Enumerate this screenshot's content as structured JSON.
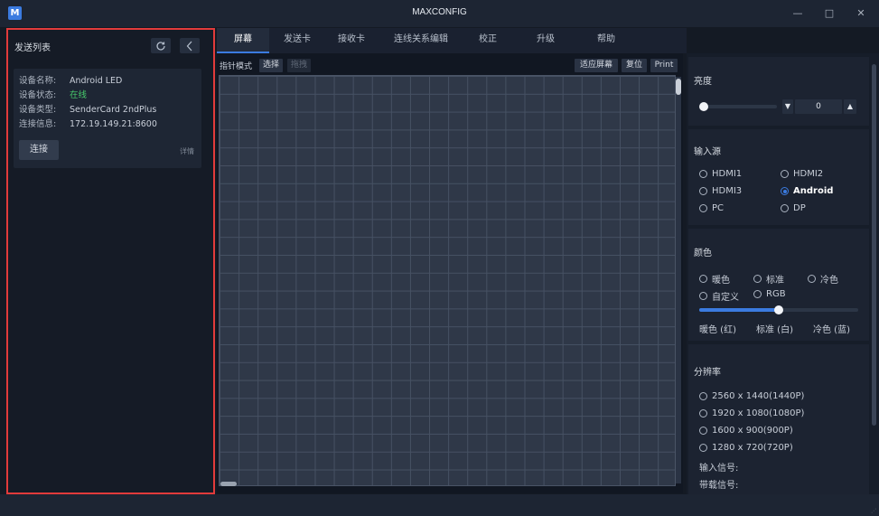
{
  "window": {
    "logo_text": "M",
    "title": "MAXCONFIG",
    "controls": {
      "minimize": "—",
      "maximize": "□",
      "close": "✕"
    }
  },
  "left_panel": {
    "title": "发送列表",
    "refresh_icon": "refresh-icon",
    "collapse_icon": "chevron-left-icon",
    "device": {
      "name_label": "设备名称:",
      "name_value": "Android LED",
      "status_label": "设备状态:",
      "status_value": "在线",
      "type_label": "设备类型:",
      "type_value": "SenderCard 2ndPlus",
      "conn_label": "连接信息:",
      "conn_value": "172.19.149.21:8600",
      "connect_button": "连接",
      "detail_link": "详情"
    }
  },
  "tabs": [
    {
      "label": "屏幕",
      "active": true
    },
    {
      "label": "发送卡",
      "active": false
    },
    {
      "label": "接收卡",
      "active": false
    },
    {
      "label": "连线关系编辑",
      "active": false
    },
    {
      "label": "校正",
      "active": false
    },
    {
      "label": "升级",
      "active": false
    },
    {
      "label": "帮助",
      "active": false
    }
  ],
  "canvas_toolbar": {
    "mode_label": "指针模式",
    "select_button": "选择",
    "drag_button": "拖拽",
    "fit_button": "适应屏幕",
    "reset_button": "复位",
    "print_button": "Print"
  },
  "right_panel": {
    "brightness": {
      "title": "亮度",
      "value": "0",
      "level": 0,
      "down_icon": "▼",
      "up_icon": "▲"
    },
    "input_source": {
      "title": "输入源",
      "options": [
        "HDMI1",
        "HDMI2",
        "HDMI3",
        "Android",
        "PC",
        "DP"
      ],
      "selected": "Android"
    },
    "color": {
      "title": "颜色",
      "options": [
        "暖色",
        "标准",
        "冷色",
        "自定义",
        "RGB"
      ],
      "slider_level": 0.5,
      "scale_labels": [
        "暖色 (红)",
        "标准 (白)",
        "冷色 (蓝)"
      ]
    },
    "resolution": {
      "title": "分辨率",
      "options": [
        "2560 x 1440(1440P)",
        "1920 x 1080(1080P)",
        "1600 x 900(900P)",
        "1280 x 720(720P)"
      ],
      "input_signal_label": "输入信号:",
      "bandwidth_signal_label": "带载信号:"
    }
  },
  "colors": {
    "accent": "#3b7be0",
    "highlight_border": "#e23b3b",
    "online": "#47c96b",
    "background": "#141a24"
  }
}
